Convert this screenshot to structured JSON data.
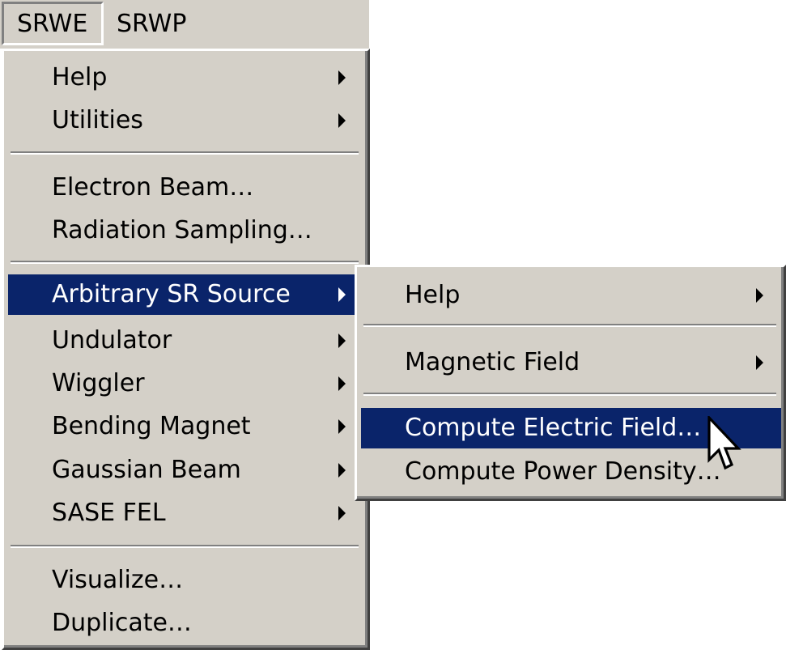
{
  "menubar": {
    "items": [
      {
        "label": "SRWE",
        "active": true
      },
      {
        "label": "SRWP",
        "active": false
      }
    ]
  },
  "main_menu": {
    "items": [
      {
        "label": "Help",
        "submenu": true
      },
      {
        "label": "Utilities",
        "submenu": true
      },
      {
        "label": "Electron Beam…",
        "submenu": false
      },
      {
        "label": "Radiation Sampling…",
        "submenu": false
      },
      {
        "label": "Arbitrary SR Source",
        "submenu": true,
        "selected": true
      },
      {
        "label": "Undulator",
        "submenu": true
      },
      {
        "label": "Wiggler",
        "submenu": true
      },
      {
        "label": "Bending Magnet",
        "submenu": true
      },
      {
        "label": "Gaussian Beam",
        "submenu": true
      },
      {
        "label": "SASE FEL",
        "submenu": true
      },
      {
        "label": "Visualize…",
        "submenu": false
      },
      {
        "label": "Duplicate…",
        "submenu": false
      }
    ]
  },
  "sub_menu": {
    "items": [
      {
        "label": "Help",
        "submenu": true
      },
      {
        "label": "Magnetic Field",
        "submenu": true
      },
      {
        "label": "Compute Electric Field…",
        "submenu": false,
        "selected": true
      },
      {
        "label": "Compute Power Density…",
        "submenu": false
      }
    ]
  },
  "colors": {
    "menu_bg": "#d4d0c8",
    "highlight_bg": "#0a246a",
    "highlight_text": "#ffffff",
    "text": "#000000"
  },
  "icons": {
    "submenu_arrow": "triangle-right-icon",
    "pointer": "mouse-pointer-icon"
  }
}
